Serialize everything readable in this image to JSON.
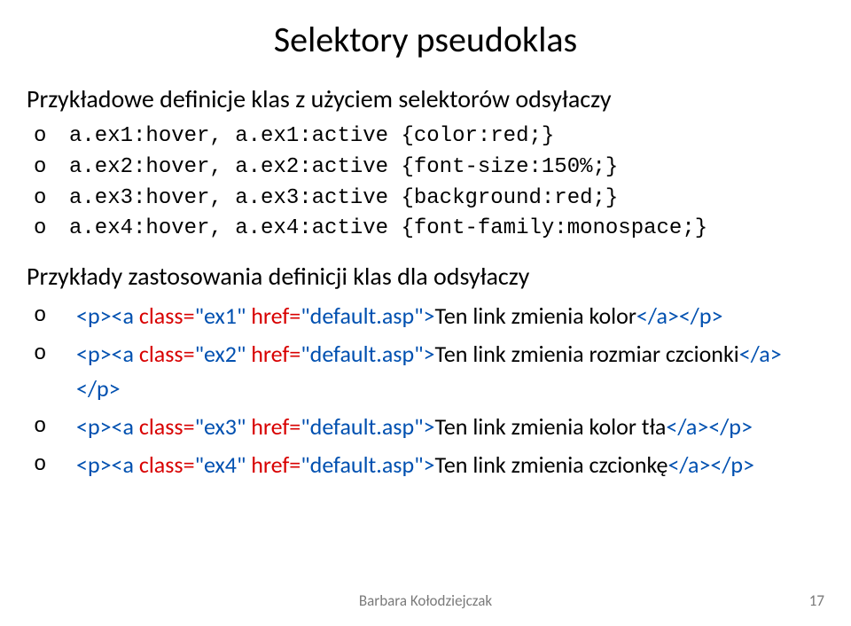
{
  "title": "Selektory pseudoklas",
  "subtitle1": "Przykładowe definicje klas z użyciem selektorów odsyłaczy",
  "code_lines": [
    "a.ex1:hover, a.ex1:active {color:red;}",
    "a.ex2:hover, a.ex2:active {font-size:150%;}",
    "a.ex3:hover, a.ex3:active {background:red;}",
    "a.ex4:hover, a.ex4:active {font-family:monospace;}"
  ],
  "subtitle2": "Przykłady  zastosowania definicji klas dla odsyłaczy",
  "htmllines": [
    {
      "tag_open1": "<p><a",
      "attr1": " class=",
      "val1": "\"ex1\"",
      "attr2": " href=",
      "val2": "\"default.asp\"",
      "tag_close1": ">",
      "text": "Ten link zmienia kolor",
      "tag_open2": "</a></p>"
    },
    {
      "tag_open1": "<p><a",
      "attr1": " class=",
      "val1": "\"ex2\"",
      "attr2": " href=",
      "val2": "\"default.asp\"",
      "tag_close1": ">",
      "text": "Ten link zmienia rozmiar czcionki",
      "tag_open2": "</a></p>"
    },
    {
      "tag_open1": "<p><a",
      "attr1": " class=",
      "val1": "\"ex3\"",
      "attr2": " href=",
      "val2": "\"default.asp\"",
      "tag_close1": ">",
      "text": "Ten link zmienia kolor tła",
      "tag_open2": "</a></p>"
    },
    {
      "tag_open1": "<p><a",
      "attr1": " class=",
      "val1": "\"ex4\"",
      "attr2": " href=",
      "val2": "\"default.asp\"",
      "tag_close1": ">",
      "text": "Ten link zmienia czcionkę",
      "tag_open2": "</a></p>"
    }
  ],
  "footer": "Barbara Kołodziejczak",
  "page_number": "17"
}
